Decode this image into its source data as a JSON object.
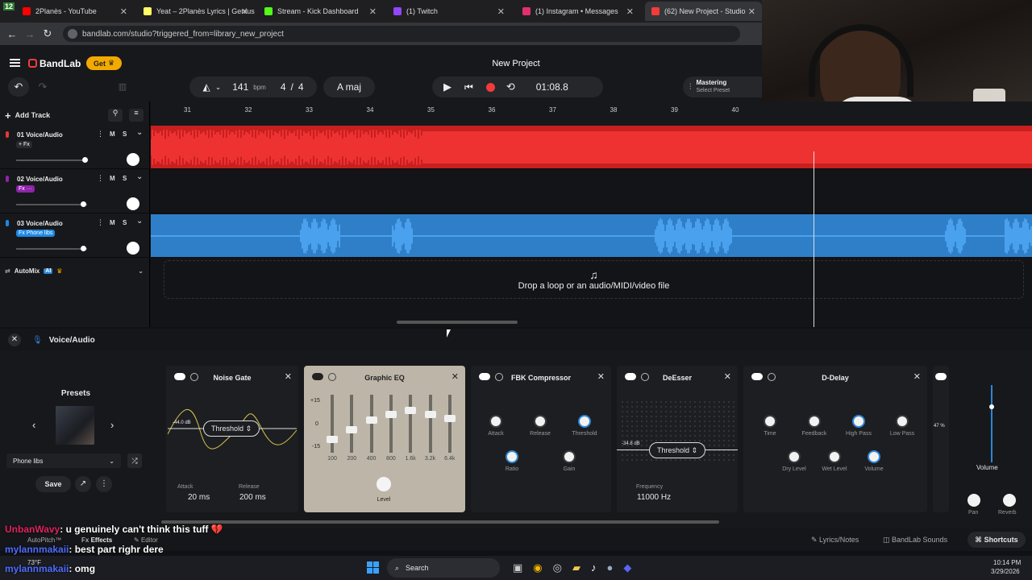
{
  "browser": {
    "tabs": [
      {
        "label": "2Planès - YouTube",
        "fav": "#ff0000"
      },
      {
        "label": "Yeat – 2Planès Lyrics | Genius Ly",
        "fav": "#ffff64"
      },
      {
        "label": "Stream - Kick Dashboard",
        "fav": "#53fc18"
      },
      {
        "label": "(1) Twitch",
        "fav": "#9146ff"
      },
      {
        "label": "(1) Instagram • Messages",
        "fav": "#e1306c"
      },
      {
        "label": "(62) New Project - Studio",
        "fav": "#f23b3b"
      }
    ],
    "tab_count_badge": "12",
    "url": "bandlab.com/studio?triggered_from=library_new_project"
  },
  "app": {
    "brand": "BandLab",
    "get_label": "Get",
    "project_title": "New Project",
    "tempo": "141",
    "tempo_unit": "bpm",
    "time_sig_num": "4",
    "time_sig_sep": "/",
    "time_sig_den": "4",
    "key": "A maj",
    "timecode": "01:08.8",
    "mastering_title": "Mastering",
    "mastering_sub": "Select Preset",
    "add_track": "Add Track",
    "bars": [
      "31",
      "32",
      "33",
      "34",
      "35",
      "36",
      "37",
      "38",
      "39",
      "40"
    ],
    "tracks": [
      {
        "name": "01  Voice/Audio",
        "fx": "+ Fx",
        "fx_color": "#2a2b2f",
        "color": "#e53935",
        "vol": 0.98
      },
      {
        "name": "02  Voice/Audio",
        "fx": "Fx ···",
        "fx_color": "#8e24aa",
        "color": "#8e24aa",
        "vol": 0.95
      },
      {
        "name": "03  Voice/Audio",
        "fx": "Fx  Phone libs",
        "fx_color": "#1e88e5",
        "color": "#1e88e5",
        "vol": 0.96
      }
    ],
    "m_label": "M",
    "s_label": "S",
    "automix": "AutoMix",
    "ai_badge": "AI",
    "drop_text": "Drop a loop or an audio/MIDI/video file"
  },
  "fx_panel": {
    "track_label": "Voice/Audio",
    "presets_title": "Presets",
    "preset_value": "Phone libs",
    "save_label": "Save",
    "noise_gate": {
      "title": "Noise Gate",
      "db": "-44.0 dB",
      "threshold": "Threshold",
      "attack_label": "Attack",
      "attack": "20 ms",
      "release_label": "Release",
      "release": "200 ms"
    },
    "graphic_eq": {
      "title": "Graphic EQ",
      "scale_top": "+15",
      "scale_mid": "0",
      "scale_bot": "-15",
      "bands": [
        "100",
        "200",
        "400",
        "800",
        "1.6k",
        "3.2k",
        "6.4k"
      ],
      "levels": [
        -8,
        -3,
        2,
        5,
        7,
        5,
        3
      ],
      "level_label": "Level"
    },
    "fbk": {
      "title": "FBK Compressor",
      "attack": "Attack",
      "release": "Release",
      "threshold": "Threshold",
      "ratio": "Ratio",
      "gain": "Gain"
    },
    "deesser": {
      "title": "DeEsser",
      "db": "-34.8 dB",
      "threshold": "Threshold",
      "freq_label": "Frequency",
      "freq": "11000 Hz"
    },
    "ddelay": {
      "title": "D-Delay",
      "time": "Time",
      "feedback": "Feedback",
      "highpass": "High Pass",
      "lowpass": "Low Pass",
      "dry": "Dry Level",
      "wet": "Wet Level",
      "volume": "Volume"
    },
    "partial_pct": "47 %",
    "right_volume": "Volume",
    "pan": "Pan",
    "reverb": "Reverb"
  },
  "footer": {
    "autopitch": "AutoPitch™",
    "effects": "Effects",
    "editor": "Editor",
    "lyrics": "Lyrics/Notes",
    "sounds": "BandLab Sounds",
    "shortcuts": "Shortcuts"
  },
  "chat": [
    {
      "user": "UnbanWavy",
      "user_color": "#e0245e",
      "msg": ": u genuinely can't think this tuff 💔"
    },
    {
      "user": "mylannmakaii",
      "user_color": "#4f6cff",
      "msg": ": best part righr dere"
    },
    {
      "user": "mylannmakaii",
      "user_color": "#4f6cff",
      "msg": ": omg"
    }
  ],
  "taskbar": {
    "temp": "73°F",
    "search": "Search",
    "time": "10:14 PM",
    "date": "3/29/2026"
  },
  "colors": {
    "accent": "#f2a900",
    "red": "#e53935",
    "blue": "#2e86d6"
  }
}
